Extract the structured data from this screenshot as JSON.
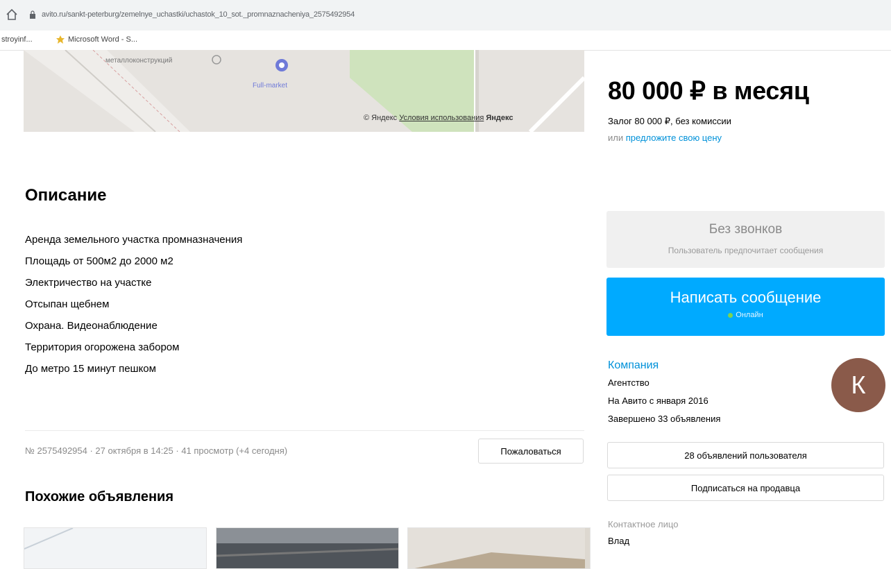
{
  "browser": {
    "url": "avito.ru/sankt-peterburg/zemelnye_uchastki/uchastok_10_sot._promnaznacheniya_2575492954",
    "bookmarks": [
      "stroyinf...",
      "Microsoft Word - S..."
    ]
  },
  "map": {
    "labels": [
      "металлоконструкций",
      "Full-market"
    ],
    "copyright": "© Яндекс",
    "terms": "Условия использования",
    "logo": "Яндекс"
  },
  "price": {
    "amount": "80 000 ₽ в месяц",
    "deposit": "Залог 80 000 ₽, без комиссии",
    "offer_prefix": "или",
    "offer_link": "предложите свою цену"
  },
  "description": {
    "title": "Описание",
    "lines": [
      "Аренда земельного участка промназначения",
      "Площадь от 500м2 до 2000 м2",
      "Электричество на участке",
      "Отсыпан щебнем",
      "Охрана. Видеонаблюдение",
      "Территория огорожена забором",
      "До метро 15 минут пешком"
    ]
  },
  "meta": {
    "info": "№ 2575492954 · 27 октября в 14:25 · 41 просмотр (+4 сегодня)",
    "complain": "Пожаловаться"
  },
  "similar": {
    "title": "Похожие объявления"
  },
  "contact": {
    "no_calls_title": "Без звонков",
    "no_calls_sub": "Пользователь предпочитает сообщения",
    "write_label": "Написать сообщение",
    "online": "Онлайн"
  },
  "seller": {
    "type_link": "Компания",
    "kind": "Агентство",
    "since": "На Авито с января 2016",
    "done": "Завершено 33 объявления",
    "avatar_letter": "К",
    "user_ads": "28 объявлений пользователя",
    "subscribe": "Подписаться на продавца",
    "contact_label": "Контактное лицо",
    "contact_name": "Влад"
  },
  "colors": {
    "accent_blue": "#00aaff",
    "link_blue": "#0091d9",
    "avatar": "#8a5a4a",
    "online_green": "#7dd44e"
  }
}
